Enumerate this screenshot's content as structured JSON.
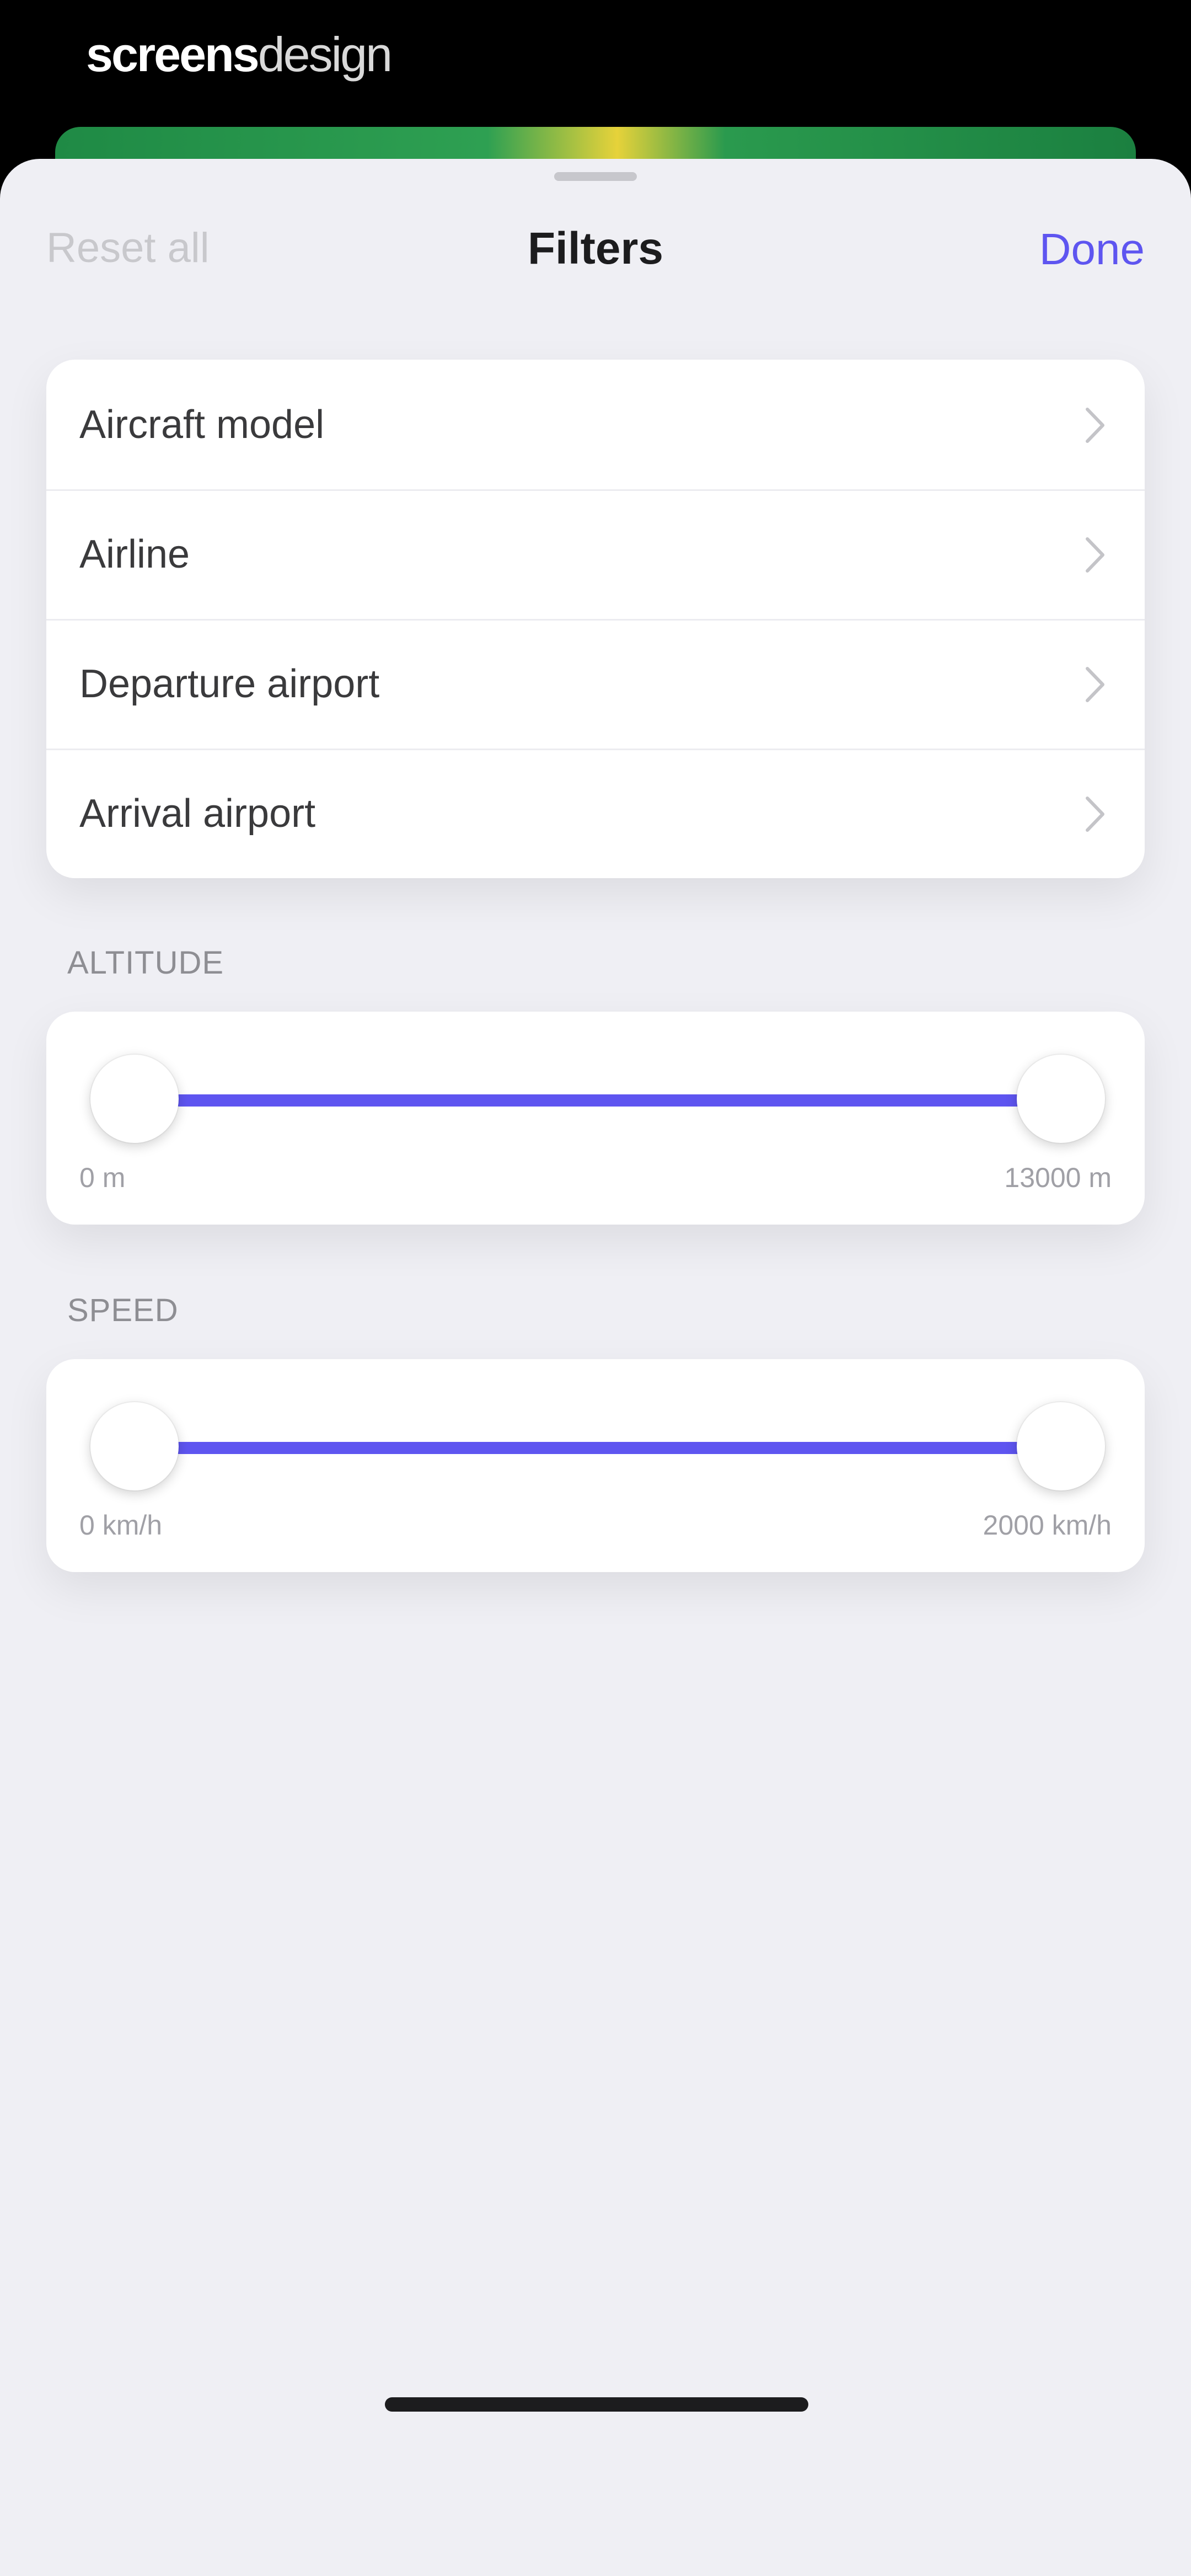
{
  "watermark": {
    "bold": "screens",
    "light": "design"
  },
  "nav": {
    "reset_label": "Reset all",
    "title": "Filters",
    "done_label": "Done"
  },
  "filters": {
    "items": [
      {
        "label": "Aircraft model"
      },
      {
        "label": "Airline"
      },
      {
        "label": "Departure airport"
      },
      {
        "label": "Arrival airport"
      }
    ]
  },
  "altitude": {
    "header": "ALTITUDE",
    "min_label": "0 m",
    "max_label": "13000 m",
    "selected_min_fraction": 0,
    "selected_max_fraction": 1
  },
  "speed": {
    "header": "SPEED",
    "min_label": "0 km/h",
    "max_label": "2000 km/h",
    "selected_min_fraction": 0,
    "selected_max_fraction": 1
  },
  "colors": {
    "accent": "#5e55f0",
    "sheet_background": "#efeff4",
    "card_background": "#ffffff",
    "disabled_text": "#c8c8cc"
  },
  "icons": {
    "row_chevron": "chevron-right-icon"
  }
}
